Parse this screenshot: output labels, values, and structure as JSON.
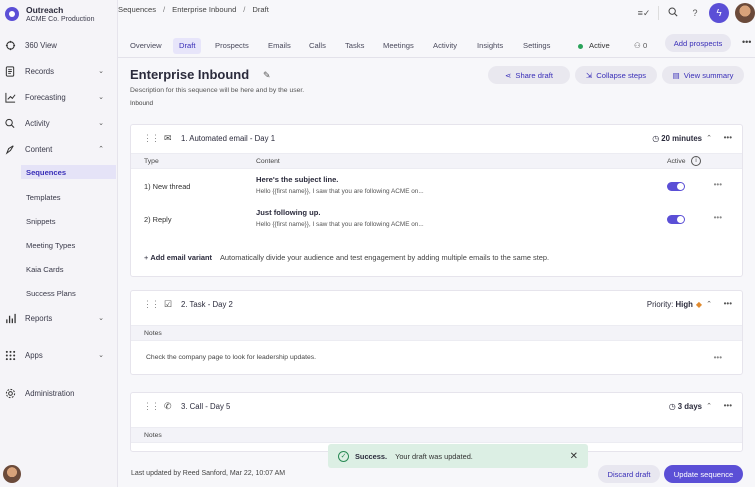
{
  "brand": {
    "name": "Outreach",
    "org": "ACME Co. Production"
  },
  "sidebar": {
    "items": [
      {
        "label": "360 View",
        "icon": "compass-icon"
      },
      {
        "label": "Records",
        "icon": "records-icon"
      },
      {
        "label": "Forecasting",
        "icon": "forecast-icon"
      },
      {
        "label": "Activity",
        "icon": "activity-icon"
      },
      {
        "label": "Content",
        "icon": "content-icon"
      },
      {
        "label": "Reports",
        "icon": "reports-icon"
      },
      {
        "label": "Apps",
        "icon": "apps-icon"
      },
      {
        "label": "Administration",
        "icon": "gear-icon"
      }
    ],
    "content_sub": [
      "Sequences",
      "Templates",
      "Snippets",
      "Meeting Types",
      "Kaia Cards",
      "Success Plans"
    ]
  },
  "breadcrumb": {
    "a": "Sequences",
    "b": "Enterprise Inbound",
    "c": "Draft"
  },
  "tabs": [
    "Overview",
    "Draft",
    "Prospects",
    "Emails",
    "Calls",
    "Tasks",
    "Meetings",
    "Activity",
    "Insights",
    "Settings"
  ],
  "status": {
    "label": "Active",
    "user_count": "0",
    "add_button": "Add prospects"
  },
  "sequence": {
    "title": "Enterprise Inbound",
    "description": "Description for this sequence will be here and by the user.",
    "tag": "Inbound",
    "share": "Share draft",
    "collapse": "Collapse steps",
    "summary": "View summary"
  },
  "step1": {
    "title": "1. Automated email - Day 1",
    "duration": "20 minutes",
    "cols": {
      "type": "Type",
      "content": "Content",
      "active": "Active"
    },
    "rows": [
      {
        "type": "1)  New thread",
        "subject": "Here's the subject line.",
        "preview": "Hello {{first name}}, I saw that you are following ACME on..."
      },
      {
        "type": "2)  Reply",
        "subject": "Just following up.",
        "preview": "Hello {{first name}}, I saw that you are following ACME on..."
      }
    ],
    "add_variant": "Add email variant",
    "add_hint": "Automatically divide your audience and test engagement by adding multiple emails to the same step."
  },
  "step2": {
    "title": "2. Task - Day 2",
    "priority_label": "Priority:",
    "priority_value": "High",
    "notes_header": "Notes",
    "note": "Check the company page to look for leadership updates."
  },
  "step3": {
    "title": "3. Call - Day 5",
    "duration": "3 days",
    "notes_header": "Notes"
  },
  "footer": {
    "updated": "Last updated by Reed Sanford, Mar 22, 10:07 AM",
    "discard": "Discard draft",
    "update": "Update sequence"
  },
  "toast": {
    "title": "Success.",
    "message": "Your draft was updated."
  },
  "colors": {
    "accent": "#5b4fd6",
    "success_bg": "#dcefe4",
    "priority": "#e08a2e"
  }
}
